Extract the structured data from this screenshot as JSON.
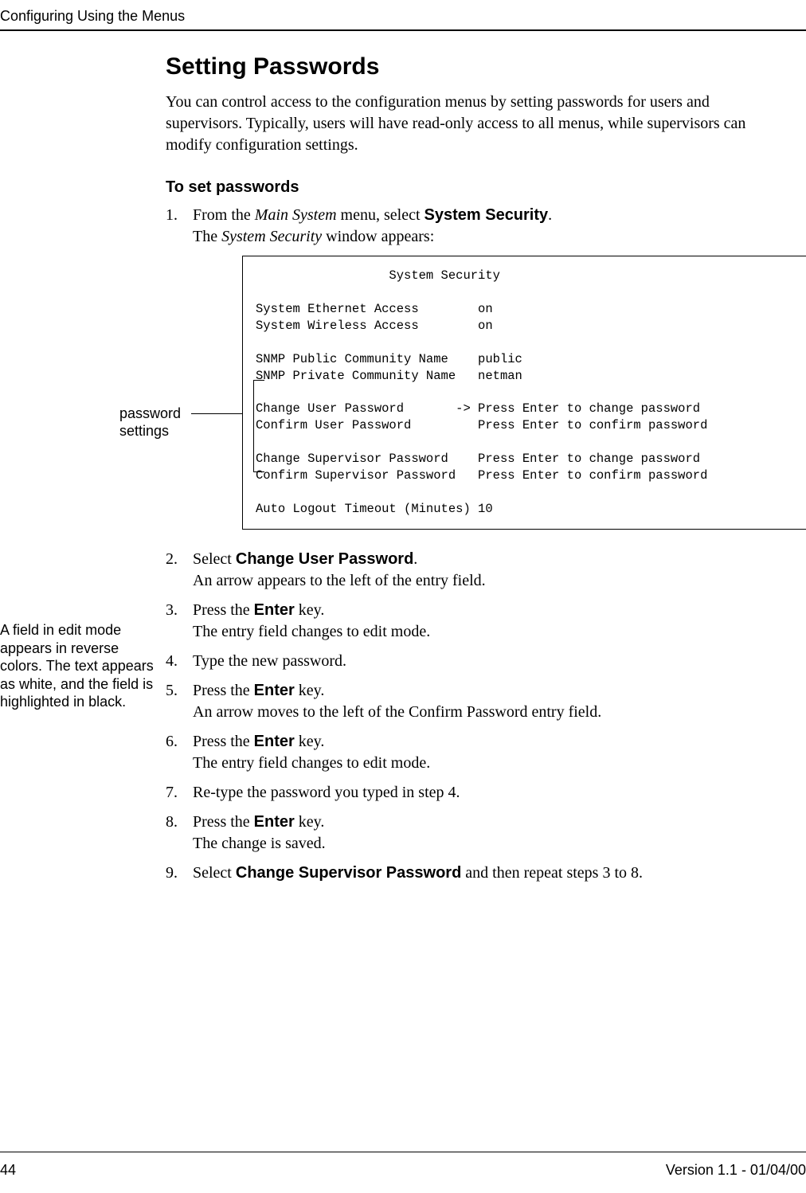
{
  "header": {
    "section": "Configuring Using the Menus"
  },
  "title": "Setting Passwords",
  "intro": "You can control access to the configuration menus by setting passwords for users and supervisors. Typically, users will have read-only access to all menus, while supervisors can modify configuration settings.",
  "subheading": "To set passwords",
  "steps": {
    "s1a": "From the ",
    "s1_menu": "Main System",
    "s1b": " menu, select ",
    "s1_ui": "System Security",
    "s1c": ".",
    "s1_result_a": "The ",
    "s1_result_em": "System Security",
    "s1_result_b": " window appears:",
    "s2a": "Select ",
    "s2_ui": "Change User Password",
    "s2b": ".",
    "s2_result": "An arrow appears to the left of the entry field.",
    "s3a": "Press the ",
    "s3_ui": "Enter",
    "s3b": " key.",
    "s3_result": "The entry field changes to edit mode.",
    "s4": "Type the new password.",
    "s5a": "Press the ",
    "s5_ui": "Enter",
    "s5b": " key.",
    "s5_result": "An arrow moves to the left of the Confirm Password entry field.",
    "s6a": "Press the ",
    "s6_ui": "Enter",
    "s6b": " key.",
    "s6_result": "The entry field changes to edit mode.",
    "s7": "Re-type the password you typed in step 4.",
    "s8a": "Press the ",
    "s8_ui": "Enter",
    "s8b": " key.",
    "s8_result": "The change is saved.",
    "s9a": "Select ",
    "s9_ui": "Change Supervisor Password",
    "s9b": " and then repeat steps 3 to 8."
  },
  "terminal": "                  System Security\n\nSystem Ethernet Access        on\nSystem Wireless Access        on\n\nSNMP Public Community Name    public\nSNMP Private Community Name   netman\n\nChange User Password       -> Press Enter to change password\nConfirm User Password         Press Enter to confirm password\n\nChange Supervisor Password    Press Enter to change password\nConfirm Supervisor Password   Press Enter to confirm password\n\nAuto Logout Timeout (Minutes) 10",
  "callout_password": "password\nsettings",
  "margin_note": "A field in edit mode appears in reverse colors. The text appears as white, and the field is highlighted in black.",
  "footer": {
    "page": "44",
    "version": "Version 1.1 - 01/04/00"
  }
}
